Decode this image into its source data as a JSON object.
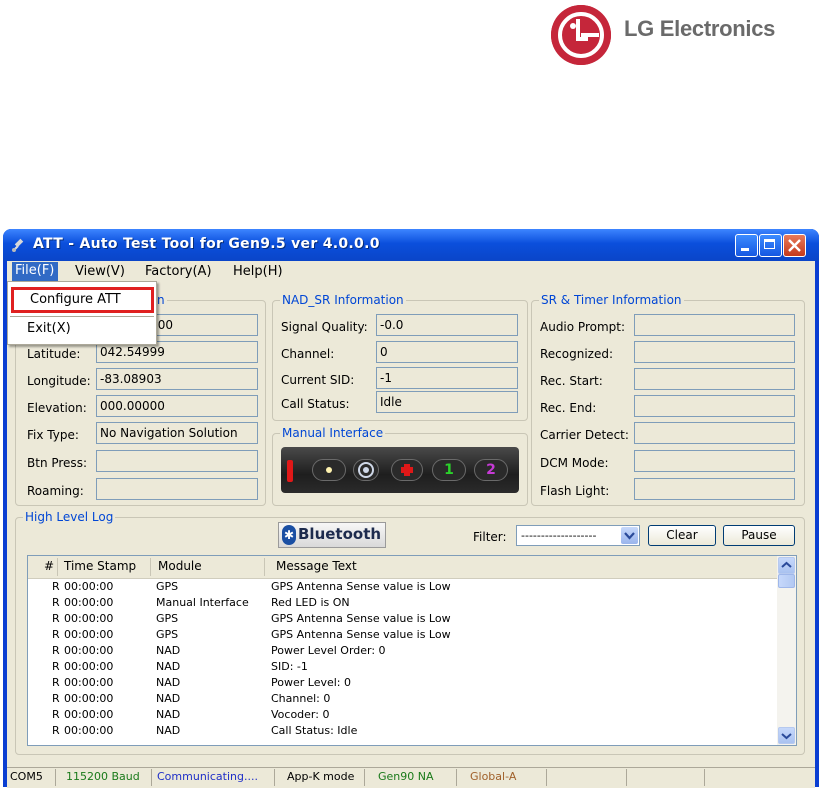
{
  "brand": {
    "name": "LG Electronics",
    "logo_icon": "lg-face-logo"
  },
  "window": {
    "title": "ATT - Auto Test Tool for Gen9.5 ver 4.0.0.0",
    "icon": "satellite-icon"
  },
  "menubar": {
    "file": "File(F)",
    "view": "View(V)",
    "factory": "Factory(A)",
    "help": "Help(H)"
  },
  "file_menu": {
    "items": [
      "Configure ATT",
      "Exit(X)"
    ],
    "highlight_color": "#e02020"
  },
  "gps_info": {
    "title_visible": "n",
    "fields": [
      {
        "label": "",
        "value": "00 00:00:00"
      },
      {
        "label": "Latitude:",
        "value": "042.54999"
      },
      {
        "label": "Longitude:",
        "value": "-83.08903"
      },
      {
        "label": "Elevation:",
        "value": "000.00000"
      },
      {
        "label": "Fix Type:",
        "value": "No Navigation Solution"
      },
      {
        "label": "Btn Press:",
        "value": ""
      },
      {
        "label": "Roaming:",
        "value": ""
      }
    ]
  },
  "nad_info": {
    "title": "NAD_SR Information",
    "fields": [
      {
        "label": "Signal Quality:",
        "value": "-0.0"
      },
      {
        "label": "Channel:",
        "value": "0"
      },
      {
        "label": "Current SID:",
        "value": "-1"
      },
      {
        "label": "Call Status:",
        "value": "Idle"
      }
    ]
  },
  "manual_interface": {
    "title": "Manual Interface",
    "buttons": [
      "red-led-icon",
      "onstar-icon",
      "emergency-cross-icon",
      "1",
      "2"
    ],
    "colors": {
      "led": "#e01818",
      "cross": "#e01818",
      "btn1": "#2bd12b",
      "btn2": "#c63ad6"
    }
  },
  "sr_timer": {
    "title": "SR & Timer Information",
    "fields": [
      {
        "label": "Audio Prompt:",
        "value": ""
      },
      {
        "label": "Recognized:",
        "value": ""
      },
      {
        "label": "Rec. Start:",
        "value": ""
      },
      {
        "label": "Rec. End:",
        "value": ""
      },
      {
        "label": "Carrier Detect:",
        "value": ""
      },
      {
        "label": "DCM Mode:",
        "value": ""
      },
      {
        "label": "Flash Light:",
        "value": ""
      }
    ]
  },
  "log": {
    "title": "High Level Log",
    "bluetooth_label": "Bluetooth",
    "filter_label": "Filter:",
    "filter_value": "-------------------",
    "clear_label": "Clear",
    "pause_label": "Pause",
    "columns": [
      "#",
      "Time Stamp",
      "Module",
      "Message Text"
    ],
    "rows": [
      [
        "R",
        "00:00:00",
        "GPS",
        "GPS Antenna Sense value is Low"
      ],
      [
        "R",
        "00:00:00",
        "Manual Interface",
        "Red LED is ON"
      ],
      [
        "R",
        "00:00:00",
        "GPS",
        "GPS Antenna Sense value is Low"
      ],
      [
        "R",
        "00:00:00",
        "GPS",
        "GPS Antenna Sense value is Low"
      ],
      [
        "R",
        "00:00:00",
        "NAD",
        "Power Level Order: 0"
      ],
      [
        "R",
        "00:00:00",
        "NAD",
        "SID: -1"
      ],
      [
        "R",
        "00:00:00",
        "NAD",
        "Power Level: 0"
      ],
      [
        "R",
        "00:00:00",
        "NAD",
        "Channel: 0"
      ],
      [
        "R",
        "00:00:00",
        "NAD",
        "Vocoder: 0"
      ],
      [
        "R",
        "00:00:00",
        "NAD",
        "Call Status: Idle"
      ]
    ]
  },
  "statusbar": {
    "cells": [
      {
        "text": "COM5",
        "color": "#000000"
      },
      {
        "text": "115200 Baud",
        "color": "#1a7a1a"
      },
      {
        "text": "Communicating....",
        "color": "#1f2fc8"
      },
      {
        "text": "App-K mode",
        "color": "#000000"
      },
      {
        "text": "Gen90 NA",
        "color": "#1a7a1a"
      },
      {
        "text": "Global-A",
        "color": "#a0602a"
      }
    ]
  }
}
